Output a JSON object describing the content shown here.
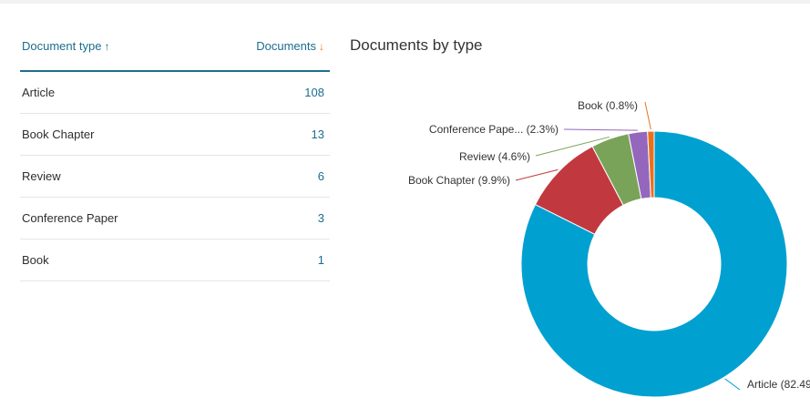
{
  "table": {
    "header_type": "Document type",
    "header_docs": "Documents",
    "rows": [
      {
        "type": "Article",
        "count": "108"
      },
      {
        "type": "Book Chapter",
        "count": "13"
      },
      {
        "type": "Review",
        "count": "6"
      },
      {
        "type": "Conference Paper",
        "count": "3"
      },
      {
        "type": "Book",
        "count": "1"
      }
    ]
  },
  "chart_data": {
    "type": "pie",
    "donut": true,
    "title": "Documents by type",
    "slices": [
      {
        "label": "Article (82.49",
        "category": "Article",
        "value": 82.4,
        "color": "#00a0d0"
      },
      {
        "label": "Book Chapter (9.9%)",
        "category": "Book Chapter",
        "value": 9.9,
        "color": "#c1393f"
      },
      {
        "label": "Review (4.6%)",
        "category": "Review",
        "value": 4.6,
        "color": "#7aa35a"
      },
      {
        "label": "Conference Pape... (2.3%)",
        "category": "Conference Paper",
        "value": 2.3,
        "color": "#9467bd"
      },
      {
        "label": "Book (0.8%)",
        "category": "Book",
        "value": 0.8,
        "color": "#e9711c"
      }
    ]
  }
}
